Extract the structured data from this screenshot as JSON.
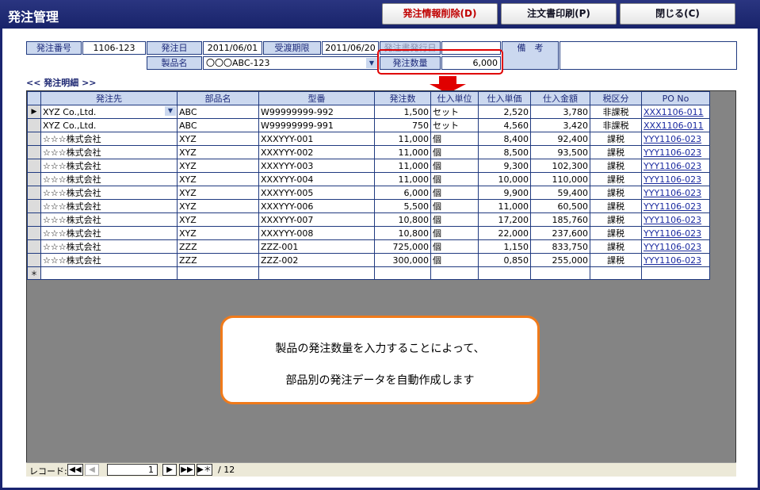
{
  "window": {
    "title": "発注管理"
  },
  "toolbar": {
    "delete_label": "発注情報削除(D)",
    "print_label": "注文書印刷(P)",
    "close_label": "閉じる(C)"
  },
  "header": {
    "order_no_label": "発注番号",
    "order_no": "1106-123",
    "order_date_label": "発注日",
    "order_date": "2011/06/01",
    "delivery_label": "受渡期限",
    "delivery_date": "2011/06/20",
    "obscured_label": "発注書発行日",
    "obscured_value": "",
    "notes_label": "備　考",
    "notes_value": "",
    "product_label": "製品名",
    "product_value": "〇〇〇ABC-123",
    "qty_label": "発注数量",
    "qty_value": "6,000"
  },
  "section": {
    "title": "<<  発注明細  >>"
  },
  "table": {
    "columns": [
      "発注先",
      "部品名",
      "型番",
      "発注数",
      "仕入単位",
      "仕入単価",
      "仕入金額",
      "税区分",
      "PO No"
    ],
    "rows": [
      [
        "XYZ Co.,Ltd.",
        "ABC",
        "W99999999-992",
        "1,500",
        "セット",
        "2,520",
        "3,780",
        "非課税",
        "XXX1106-011"
      ],
      [
        "XYZ Co.,Ltd.",
        "ABC",
        "W99999999-991",
        "750",
        "セット",
        "4,560",
        "3,420",
        "非課税",
        "XXX1106-011"
      ],
      [
        "☆☆☆株式会社",
        "XYZ",
        "XXXYYY-001",
        "11,000",
        "個",
        "8,400",
        "92,400",
        "課税",
        "YYY1106-023"
      ],
      [
        "☆☆☆株式会社",
        "XYZ",
        "XXXYYY-002",
        "11,000",
        "個",
        "8,500",
        "93,500",
        "課税",
        "YYY1106-023"
      ],
      [
        "☆☆☆株式会社",
        "XYZ",
        "XXXYYY-003",
        "11,000",
        "個",
        "9,300",
        "102,300",
        "課税",
        "YYY1106-023"
      ],
      [
        "☆☆☆株式会社",
        "XYZ",
        "XXXYYY-004",
        "11,000",
        "個",
        "10,000",
        "110,000",
        "課税",
        "YYY1106-023"
      ],
      [
        "☆☆☆株式会社",
        "XYZ",
        "XXXYYY-005",
        "6,000",
        "個",
        "9,900",
        "59,400",
        "課税",
        "YYY1106-023"
      ],
      [
        "☆☆☆株式会社",
        "XYZ",
        "XXXYYY-006",
        "5,500",
        "個",
        "11,000",
        "60,500",
        "課税",
        "YYY1106-023"
      ],
      [
        "☆☆☆株式会社",
        "XYZ",
        "XXXYYY-007",
        "10,800",
        "個",
        "17,200",
        "185,760",
        "課税",
        "YYY1106-023"
      ],
      [
        "☆☆☆株式会社",
        "XYZ",
        "XXXYYY-008",
        "10,800",
        "個",
        "22,000",
        "237,600",
        "課税",
        "YYY1106-023"
      ],
      [
        "☆☆☆株式会社",
        "ZZZ",
        "ZZZ-001",
        "725,000",
        "個",
        "1,150",
        "833,750",
        "課税",
        "YYY1106-023"
      ],
      [
        "☆☆☆株式会社",
        "ZZZ",
        "ZZZ-002",
        "300,000",
        "個",
        "0,850",
        "255,000",
        "課税",
        "YYY1106-023"
      ]
    ],
    "new_row_marker": "＊",
    "current_row_marker": "▶"
  },
  "nav": {
    "label": "レコード:",
    "current": "1",
    "total": "/ 12",
    "first": "◀◀",
    "prev": "◀",
    "next": "▶",
    "last": "▶▶",
    "new": "▶＊"
  },
  "callout": {
    "line1": "製品の発注数量を入力することによって、",
    "line2": "部品別の発注データを自動作成します"
  },
  "colors": {
    "titlebar": "#1e2a72",
    "label_bg": "#cbd8ef",
    "highlight": "#e00000",
    "callout_border": "#f07a1a",
    "arrow": "#e00000"
  }
}
